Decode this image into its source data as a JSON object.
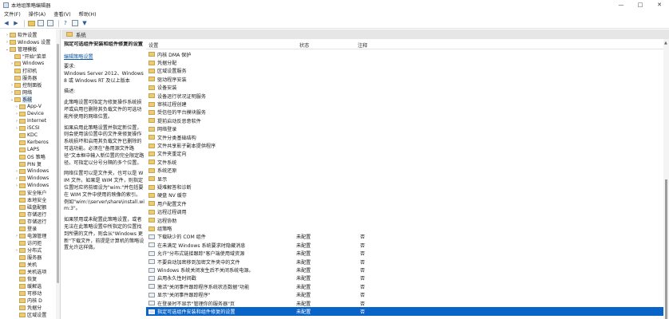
{
  "window": {
    "title": "本地组策略编辑器",
    "buttons": [
      "—",
      "□",
      "✕"
    ]
  },
  "menu": [
    "文件(F)",
    "操作(A)",
    "查看(V)",
    "帮助(H)"
  ],
  "toolbar": {
    "icons": [
      "back-arrow-icon",
      "forward-arrow-icon",
      "folder-up-icon",
      "show-hide-tree-icon",
      "export-icon",
      "help-icon",
      "properties-icon",
      "filter-icon"
    ]
  },
  "tree": [
    {
      "label": "软件设置",
      "indent": 2,
      "exp": "›"
    },
    {
      "label": "Windows 设置",
      "indent": 2,
      "exp": "›"
    },
    {
      "label": "管理模板",
      "indent": 2,
      "exp": "⌄"
    },
    {
      "label": "\"开始\"菜单",
      "indent": 3,
      "exp": ""
    },
    {
      "label": "Windows",
      "indent": 3,
      "exp": "›"
    },
    {
      "label": "打印机",
      "indent": 3,
      "exp": ""
    },
    {
      "label": "服务器",
      "indent": 3,
      "exp": ""
    },
    {
      "label": "控制面板",
      "indent": 3,
      "exp": "›"
    },
    {
      "label": "网络",
      "indent": 3,
      "exp": "›"
    },
    {
      "label": "系统",
      "indent": 3,
      "exp": "⌄",
      "selected": true
    },
    {
      "label": "App-V",
      "indent": 4,
      "exp": "›"
    },
    {
      "label": "Device",
      "indent": 4,
      "exp": "›"
    },
    {
      "label": "Internet",
      "indent": 4,
      "exp": "›"
    },
    {
      "label": "iSCSI",
      "indent": 4,
      "exp": "›"
    },
    {
      "label": "KDC",
      "indent": 4,
      "exp": ""
    },
    {
      "label": "Kerberos",
      "indent": 4,
      "exp": ""
    },
    {
      "label": "LAPS",
      "indent": 4,
      "exp": ""
    },
    {
      "label": "OS 策略",
      "indent": 4,
      "exp": ""
    },
    {
      "label": "PIN 复",
      "indent": 4,
      "exp": ""
    },
    {
      "label": "Windows",
      "indent": 4,
      "exp": "›"
    },
    {
      "label": "Windows",
      "indent": 4,
      "exp": "›"
    },
    {
      "label": "Windows",
      "indent": 4,
      "exp": "›"
    },
    {
      "label": "安全帐户",
      "indent": 4,
      "exp": ""
    },
    {
      "label": "本地安全",
      "indent": 4,
      "exp": ""
    },
    {
      "label": "磁盘配额",
      "indent": 4,
      "exp": ""
    },
    {
      "label": "存储运行",
      "indent": 4,
      "exp": ""
    },
    {
      "label": "存储运行",
      "indent": 4,
      "exp": ""
    },
    {
      "label": "登录",
      "indent": 4,
      "exp": ""
    },
    {
      "label": "电源管理",
      "indent": 4,
      "exp": "›"
    },
    {
      "label": "访问拒",
      "indent": 4,
      "exp": ""
    },
    {
      "label": "分布式",
      "indent": 4,
      "exp": "›"
    },
    {
      "label": "服务器",
      "indent": 4,
      "exp": ""
    },
    {
      "label": "关机",
      "indent": 4,
      "exp": ""
    },
    {
      "label": "关机选项",
      "indent": 4,
      "exp": ""
    },
    {
      "label": "恢复",
      "indent": 4,
      "exp": ""
    },
    {
      "label": "缓解选",
      "indent": 4,
      "exp": ""
    },
    {
      "label": "可移动",
      "indent": 4,
      "exp": ""
    },
    {
      "label": "内核 D",
      "indent": 4,
      "exp": ""
    },
    {
      "label": "凭据分",
      "indent": 4,
      "exp": ""
    },
    {
      "label": "区域设置",
      "indent": 4,
      "exp": ""
    }
  ],
  "breadcrumb": "系统",
  "description": {
    "title": "指定可选组件安装和组件修复的设置",
    "edit_link": "编辑策略设置",
    "requirement": "要求:\nWindows Server 2012、Windows 8 或 Windows RT 及以上版本",
    "desc_label": "描述:",
    "p1": "此策略设置可指定为修复操作系统损坏或启用已删除其负载文件的可选功能所使用的网络位置。",
    "p2": "如果启用此策略设置并指定新位置，则会使用该位置中的文件来修复操作系统损坏和启用其负载文件已删除的可选功能。必须在\"备用源文件路径\"文本框中输入新位置的完全限定路径。可指定以分号分隔的多个位置。",
    "p3": "网络位置可以是文件夹，也可以是 WIM 文件。如果是 WIM 文件，则指定位置时应将前缀设为\"wim:\"并包括要在 WIM 文件中使用的映像的索引。例如\"wim:\\\\server\\share\\install.wim:3\"。",
    "p4": "如果禁用或未配置此策略设置，或者无法在此策略设置中所指定的位置找到所需的文件，则会从\"Windows 更新\"下载文件，前提是计算机的策略设置允许这样做。"
  },
  "list": {
    "headers": {
      "setting": "设置",
      "state": "状态",
      "note": "注释"
    },
    "folders": [
      "内核 DMA 保护",
      "凭据分配",
      "区域设置服务",
      "驱动程序安装",
      "设备安装",
      "设备运行状况证明服务",
      "审核过程创建",
      "受信任的平台模块服务",
      "提前启动反恶意软件",
      "网络登录",
      "文件分类基础结构",
      "文件共享影子副本提供程序",
      "文件夹重定向",
      "文件系统",
      "系统还原",
      "显示",
      "疑难解答和诊断",
      "硬盘 NV 缓存",
      "用户配置文件",
      "远程过程调用",
      "远程协助",
      "组策略"
    ],
    "settings": [
      {
        "name": "下载缺少的 COM 组件",
        "state": "未配置",
        "note": "否"
      },
      {
        "name": "在未满足 Windows 系统要求时隐藏消息",
        "state": "未配置",
        "note": "否"
      },
      {
        "name": "允许\"分布式链接跟踪\"客户端使用域资源",
        "state": "未配置",
        "note": "否"
      },
      {
        "name": "不要自动加密移到加密文件夹中的文件",
        "state": "未配置",
        "note": "否"
      },
      {
        "name": "Windows 系统关闭发生后不关闭系统电源。",
        "state": "未配置",
        "note": "否"
      },
      {
        "name": "启用永久性时间戳",
        "state": "未配置",
        "note": "否"
      },
      {
        "name": "激活\"关闭事件跟踪程序系统状态数据\"功能",
        "state": "未配置",
        "note": "否"
      },
      {
        "name": "显示\"关闭事件跟踪程序\"",
        "state": "未配置",
        "note": "否"
      },
      {
        "name": "在登录时不显示\"管理你的服务器\"页",
        "state": "未配置",
        "note": "否"
      },
      {
        "name": "指定可选组件安装和组件修复的设置",
        "state": "未配置",
        "note": "否",
        "selected": true
      }
    ]
  }
}
